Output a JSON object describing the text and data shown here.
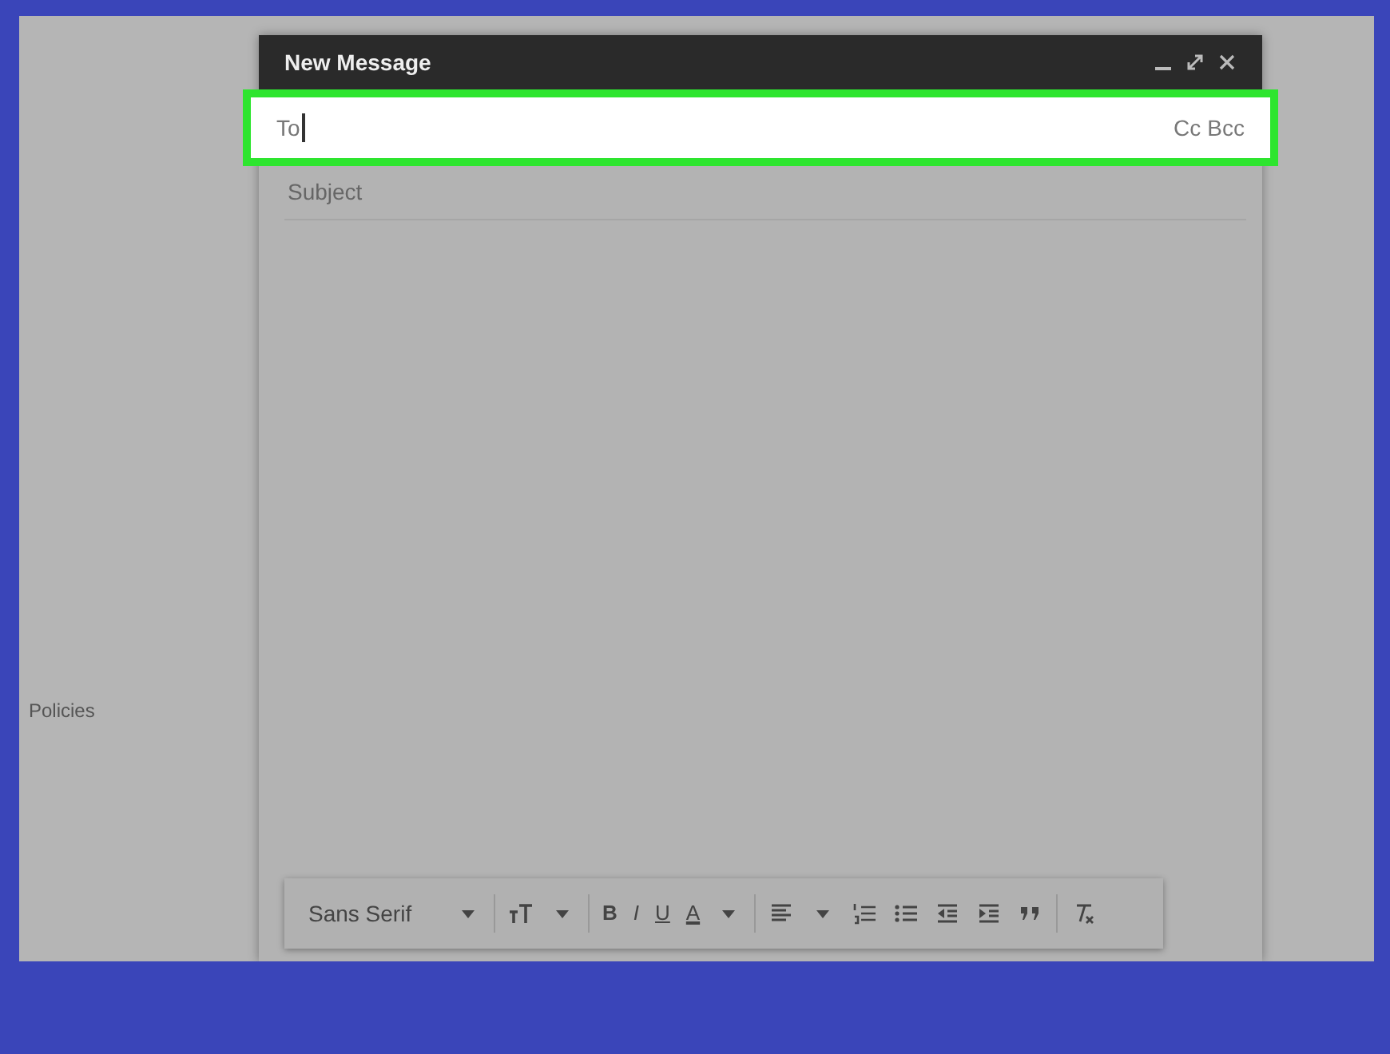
{
  "background": {
    "side_text": "Policies"
  },
  "compose": {
    "title": "New Message",
    "to_field": {
      "label": "To",
      "highlighted": true,
      "focused": true,
      "cc": "Cc",
      "bcc": "Bcc"
    },
    "subject": {
      "placeholder": "Subject"
    },
    "toolbar": {
      "font": "Sans Serif",
      "format_buttons": [
        "B",
        "I",
        "U",
        "A"
      ]
    }
  }
}
